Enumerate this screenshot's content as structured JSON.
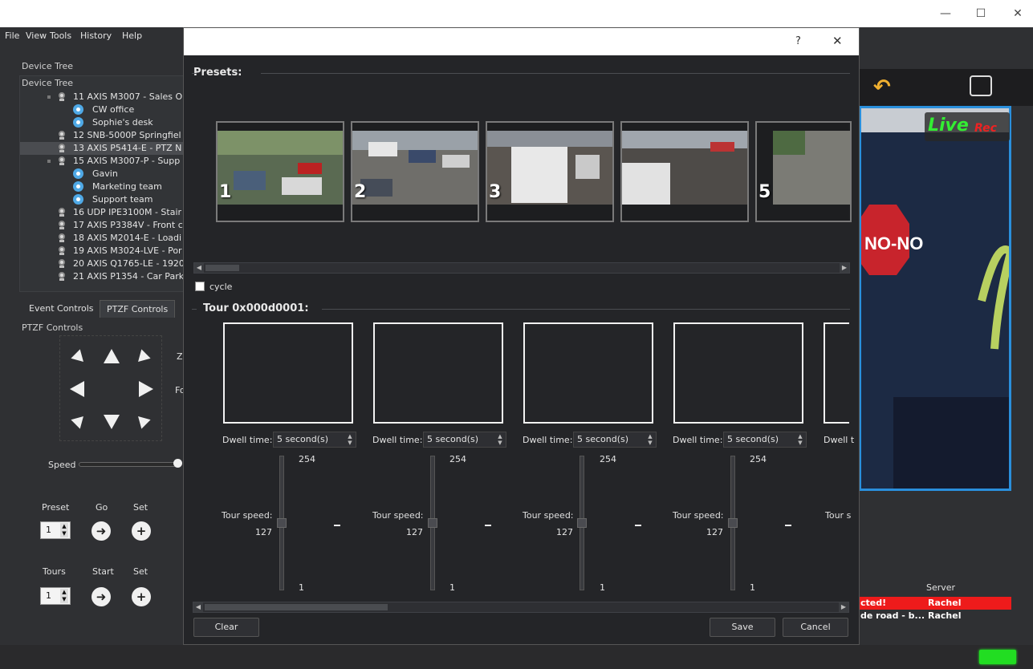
{
  "os": {
    "minimize": "—",
    "maximize": "☐",
    "close": "✕"
  },
  "menu": {
    "file": "File",
    "view": "View",
    "tools": "Tools",
    "history": "History",
    "help": "Help"
  },
  "device_tree": {
    "title": "Device Tree",
    "header": "Device Tree",
    "items": [
      "11 AXIS M3007 - Sales O",
      "CW office",
      "Sophie's desk",
      "12 SNB-5000P Springfiel",
      "13 AXIS P5414-E - PTZ N",
      "15 AXIS M3007-P - Supp",
      "Gavin",
      "Marketing team",
      "Support team",
      "16 UDP IPE3100M - Stair",
      "17 AXIS P3384V - Front c",
      "18 AXIS M2014-E - Loadi",
      "19 AXIS M3024-LVE - Por",
      "20 AXIS Q1765-LE - 1920",
      "21 AXIS P1354 - Car Park"
    ]
  },
  "tabs": {
    "event": "Event Controls",
    "ptzf": "PTZF Controls"
  },
  "ptzf": {
    "title": "PTZF Controls",
    "zoom_label": "Z",
    "focus_label": "Fo",
    "speed_label": "Speed",
    "preset_label": "Preset",
    "go_label": "Go",
    "set_label": "Set",
    "preset_value": "1",
    "tours_label": "Tours",
    "start_label": "Start",
    "set2_label": "Set",
    "tours_value": "1"
  },
  "overlay": {
    "live": "Live",
    "rec": "Rec"
  },
  "events": {
    "server_header": "Server",
    "row1_text": "cted!",
    "row1_server": "Rachel",
    "row2_text": "de road - b...",
    "row2_server": "Rachel"
  },
  "dialog": {
    "help": "?",
    "close": "✕",
    "presets_label": "Presets:",
    "preset_numbers": [
      "1",
      "2",
      "3",
      "",
      "5"
    ],
    "cycle_label": "cycle",
    "tour_label": "Tour 0x000d0001:",
    "dwell_label": "Dwell time:",
    "dwell_value": "5 second(s)",
    "dwell_cut": "Dwell t",
    "tour_speed_label": "Tour speed:",
    "tour_speed_cut": "Tour s",
    "speed_max": "254",
    "speed_mid": "127",
    "speed_min": "1",
    "clear": "Clear",
    "save": "Save",
    "cancel": "Cancel"
  }
}
